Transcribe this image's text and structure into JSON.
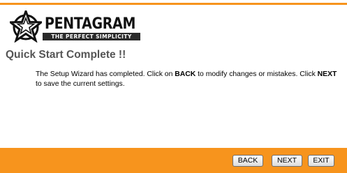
{
  "brand": {
    "name": "PENTAGRAM",
    "tagline": "THE PERFECT SIMPLICITY",
    "accent_color": "#f7941d",
    "logo_icon": "star-in-circle-icon"
  },
  "page": {
    "title": "Quick Start Complete !!",
    "message_part1": "The Setup Wizard has completed. Click on ",
    "message_back": "BACK",
    "message_part2": " to modify changes or mistakes. Click ",
    "message_next": "NEXT",
    "message_part3": " to save the current settings."
  },
  "buttons": {
    "back": "BACK",
    "next": "NEXT",
    "exit": "EXIT"
  }
}
